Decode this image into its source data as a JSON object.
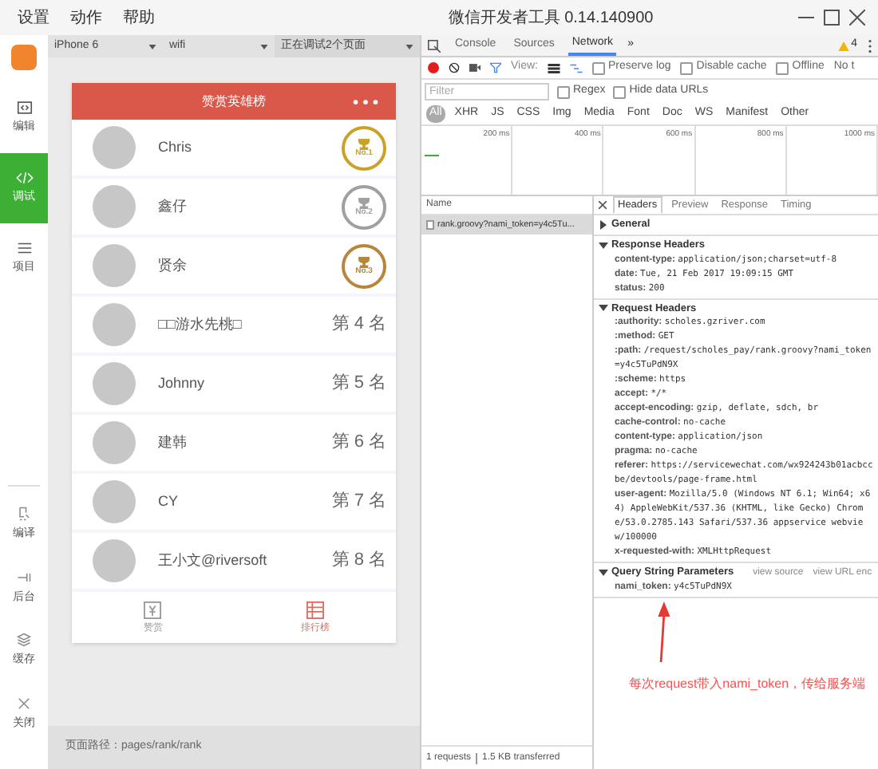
{
  "menu": [
    "设置",
    "动作",
    "帮助"
  ],
  "window": {
    "title": "微信开发者工具 0.14.140900"
  },
  "sidebar": {
    "items": [
      {
        "label": "编辑",
        "kind": "edit",
        "selected": false
      },
      {
        "label": "调试",
        "kind": "debug",
        "selected": true
      },
      {
        "label": "项目",
        "kind": "project",
        "selected": false
      }
    ],
    "actions": [
      {
        "label": "编译",
        "kind": "compile"
      },
      {
        "label": "后台",
        "kind": "background"
      },
      {
        "label": "缓存",
        "kind": "cache"
      },
      {
        "label": "关闭",
        "kind": "close"
      }
    ]
  },
  "simulator": {
    "device": "iPhone 6",
    "network": "wifi",
    "pages": "正在调试2个页面",
    "path": "页面路径：pages/rank/rank"
  },
  "phone": {
    "title": "赞赏英雄榜",
    "ranking": [
      {
        "name": "Chris",
        "kind": "medal",
        "badge": "No.1",
        "color": "#c9a227"
      },
      {
        "name": "鑫仔",
        "kind": "medal",
        "badge": "No.2",
        "color": "#a0a0a0"
      },
      {
        "name": "贤余",
        "kind": "medal",
        "badge": "No.3",
        "color": "#b8863b"
      },
      {
        "name": "□□游水先桃□",
        "kind": "text",
        "rank": "第 4 名"
      },
      {
        "name": "Johnny",
        "kind": "text",
        "rank": "第 5 名"
      },
      {
        "name": "建韩",
        "kind": "text",
        "rank": "第 6 名"
      },
      {
        "name": "CY",
        "kind": "text",
        "rank": "第 7 名"
      },
      {
        "name": "王小文@riversoft",
        "kind": "text",
        "rank": "第 8 名"
      }
    ],
    "tabbar": [
      {
        "label": "赞赏",
        "kind": "reward",
        "selected": false
      },
      {
        "label": "排行榜",
        "kind": "list",
        "selected": true
      }
    ]
  },
  "devtools": {
    "tabs": [
      {
        "label": "Console",
        "selected": false
      },
      {
        "label": "Sources",
        "selected": false
      },
      {
        "label": "Network",
        "selected": true
      }
    ],
    "more": "»",
    "warnings": "4",
    "view_label": "View:",
    "options": [
      {
        "label": "Preserve log",
        "checked": false
      },
      {
        "label": "Disable cache",
        "checked": false
      },
      {
        "label": "Offline",
        "checked": false
      }
    ],
    "cut_option": "No t",
    "filter": {
      "placeholder": "Filter"
    },
    "filter_options": [
      {
        "label": "Regex",
        "checked": false
      },
      {
        "label": "Hide data URLs",
        "checked": false
      }
    ],
    "types": [
      {
        "label": "All",
        "selected": true
      },
      {
        "label": "XHR",
        "selected": false
      },
      {
        "label": "JS",
        "selected": false
      },
      {
        "label": "CSS",
        "selected": false
      },
      {
        "label": "Img",
        "selected": false
      },
      {
        "label": "Media",
        "selected": false
      },
      {
        "label": "Font",
        "selected": false
      },
      {
        "label": "Doc",
        "selected": false
      },
      {
        "label": "WS",
        "selected": false
      },
      {
        "label": "Manifest",
        "selected": false
      },
      {
        "label": "Other",
        "selected": false
      }
    ],
    "timeline": [
      "200 ms",
      "400 ms",
      "600 ms",
      "800 ms",
      "1000 ms"
    ],
    "requests": {
      "header": "Name",
      "rows": [
        {
          "name": "rank.groovy?nami_token=y4c5Tu...",
          "selected": true
        }
      ],
      "summary": [
        "1 requests",
        "1.5 KB transferred"
      ]
    },
    "detail_tabs": [
      {
        "label": "Headers",
        "selected": true
      },
      {
        "label": "Preview",
        "selected": false
      },
      {
        "label": "Response",
        "selected": false
      },
      {
        "label": "Timing",
        "selected": false
      }
    ],
    "sections": [
      {
        "title": "General",
        "expanded": false
      },
      {
        "title": "Response Headers",
        "expanded": true,
        "headers": [
          {
            "key": "content-type:",
            "value": "application/json;charset=utf-8"
          },
          {
            "key": "date:",
            "value": "Tue, 21 Feb 2017 19:09:15 GMT"
          },
          {
            "key": "status:",
            "value": "200"
          }
        ]
      },
      {
        "title": "Request Headers",
        "expanded": true,
        "headers": [
          {
            "key": ":authority:",
            "value": "scholes.gzriver.com"
          },
          {
            "key": ":method:",
            "value": "GET"
          },
          {
            "key": ":path:",
            "value": "/request/scholes_pay/rank.groovy?nami_token=y4c5TuPdN9X"
          },
          {
            "key": ":scheme:",
            "value": "https"
          },
          {
            "key": "accept:",
            "value": "*/*"
          },
          {
            "key": "accept-encoding:",
            "value": "gzip, deflate, sdch, br"
          },
          {
            "key": "cache-control:",
            "value": "no-cache"
          },
          {
            "key": "content-type:",
            "value": "application/json"
          },
          {
            "key": "pragma:",
            "value": "no-cache"
          },
          {
            "key": "referer:",
            "value": "https://servicewechat.com/wx924243b01acbccbe/devtools/page-frame.html"
          },
          {
            "key": "user-agent:",
            "value": "Mozilla/5.0 (Windows NT 6.1; Win64; x64) AppleWebKit/537.36 (KHTML, like Gecko) Chrome/53.0.2785.143 Safari/537.36 appservice webview/100000"
          },
          {
            "key": "x-requested-with:",
            "value": "XMLHttpRequest"
          }
        ]
      },
      {
        "title": "Query String Parameters",
        "expanded": true,
        "links": [
          "view source",
          "view URL enc"
        ],
        "headers": [
          {
            "key": "nami_token:",
            "value": "y4c5TuPdN9X"
          }
        ]
      }
    ]
  },
  "annotation": "每次request带入nami_token，传给服务端"
}
